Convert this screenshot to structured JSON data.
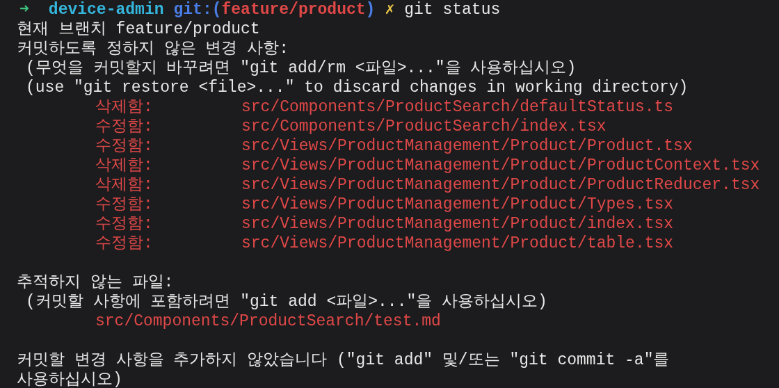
{
  "prompt": {
    "arrow": "➜",
    "directory": "device-admin",
    "git_prefix": "git:(",
    "branch": "feature/product",
    "git_suffix": ")",
    "dirty_mark": "✗",
    "command": "git status"
  },
  "lines": [
    {
      "kind": "text",
      "text": "현재 브랜치 feature/product"
    },
    {
      "kind": "text",
      "text": "커밋하도록 정하지 않은 변경 사항:"
    },
    {
      "kind": "hint",
      "text": "(무엇을 커밋할지 바꾸려면 \"git add/rm <파일>...\"을 사용하십시오)"
    },
    {
      "kind": "hint",
      "text": "(use \"git restore <file>...\" to discard changes in working directory)"
    },
    {
      "kind": "change",
      "status": "삭제함:",
      "path": "src/Components/ProductSearch/defaultStatus.ts"
    },
    {
      "kind": "change",
      "status": "수정함:",
      "path": "src/Components/ProductSearch/index.tsx"
    },
    {
      "kind": "change",
      "status": "수정함:",
      "path": "src/Views/ProductManagement/Product/Product.tsx"
    },
    {
      "kind": "change",
      "status": "삭제함:",
      "path": "src/Views/ProductManagement/Product/ProductContext.tsx"
    },
    {
      "kind": "change",
      "status": "삭제함:",
      "path": "src/Views/ProductManagement/Product/ProductReducer.tsx"
    },
    {
      "kind": "change",
      "status": "수정함:",
      "path": "src/Views/ProductManagement/Product/Types.tsx"
    },
    {
      "kind": "change",
      "status": "수정함:",
      "path": "src/Views/ProductManagement/Product/index.tsx"
    },
    {
      "kind": "change",
      "status": "수정함:",
      "path": "src/Views/ProductManagement/Product/table.tsx"
    },
    {
      "kind": "blank"
    },
    {
      "kind": "text",
      "text": "추적하지 않는 파일:"
    },
    {
      "kind": "hint",
      "text": "(커밋할 사항에 포함하려면 \"git add <파일>...\"을 사용하십시오)"
    },
    {
      "kind": "untracked",
      "path": "src/Components/ProductSearch/test.md"
    },
    {
      "kind": "blank"
    },
    {
      "kind": "text",
      "text": "커밋할 변경 사항을 추가하지 않았습니다 (\"git add\" 및/또는 \"git commit -a\"를"
    },
    {
      "kind": "text",
      "text": "사용하십시오)"
    }
  ]
}
